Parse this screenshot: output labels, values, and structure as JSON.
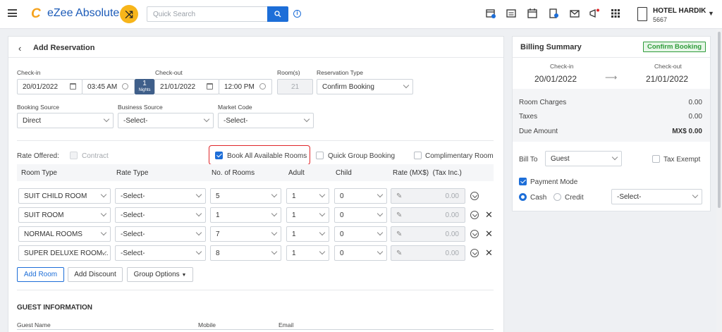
{
  "topbar": {
    "logo_mark": "C",
    "app_name": "eZee Absolute",
    "search_placeholder": "Quick Search",
    "hotel_name": "HOTEL HARDIK",
    "hotel_id": "5667"
  },
  "page": {
    "title": "Add Reservation"
  },
  "stay": {
    "checkin_label": "Check-in",
    "checkout_label": "Check-out",
    "rooms_label": "Room(s)",
    "restype_label": "Reservation Type",
    "checkin_date": "20/01/2022",
    "checkin_time": "03:45 AM",
    "nights_count": "1",
    "nights_label": "Nights",
    "checkout_date": "21/01/2022",
    "checkout_time": "12:00 PM",
    "rooms": "21",
    "reservation_type": "Confirm Booking"
  },
  "sources": {
    "booking_label": "Booking Source",
    "business_label": "Business Source",
    "market_label": "Market Code",
    "booking_value": "Direct",
    "business_value": "-Select-",
    "market_value": "-Select-"
  },
  "options": {
    "rate_offered": "Rate Offered:",
    "contract": "Contract",
    "book_all": "Book All Available Rooms",
    "quick_group": "Quick Group Booking",
    "complimentary": "Complimentary Room"
  },
  "table": {
    "headers": [
      "Room Type",
      "Rate Type",
      "No. of Rooms",
      "Adult",
      "Child",
      "Rate (MX$)  (Tax Inc.)"
    ],
    "rows": [
      {
        "room_type": "SUIT CHILD ROOM",
        "rate_type": "-Select-",
        "rooms": "5",
        "adult": "1",
        "child": "0",
        "rate": "0.00"
      },
      {
        "room_type": "SUIT ROOM",
        "rate_type": "-Select-",
        "rooms": "1",
        "adult": "1",
        "child": "0",
        "rate": "0.00"
      },
      {
        "room_type": "NORMAL ROOMS",
        "rate_type": "-Select-",
        "rooms": "7",
        "adult": "1",
        "child": "0",
        "rate": "0.00"
      },
      {
        "room_type": "SUPER DELUXE ROOM...",
        "rate_type": "-Select-",
        "rooms": "8",
        "adult": "1",
        "child": "0",
        "rate": "0.00"
      }
    ]
  },
  "buttons": {
    "add_room": "Add Room",
    "add_discount": "Add Discount",
    "group_options": "Group Options"
  },
  "guest": {
    "section_title": "GUEST INFORMATION",
    "name_label": "Guest Name",
    "mobile_label": "Mobile",
    "email_label": "Email"
  },
  "billing": {
    "title": "Billing Summary",
    "badge": "Confirm Booking",
    "checkin_label": "Check-in",
    "checkout_label": "Check-out",
    "checkin_date": "20/01/2022",
    "checkout_date": "21/01/2022",
    "arrow": "⟶",
    "room_charges_label": "Room Charges",
    "room_charges": "0.00",
    "taxes_label": "Taxes",
    "taxes": "0.00",
    "due_label": "Due Amount",
    "due": "MX$ 0.00",
    "bill_to_label": "Bill To",
    "bill_to_value": "Guest",
    "tax_exempt": "Tax Exempt",
    "payment_mode": "Payment Mode",
    "cash": "Cash",
    "credit": "Credit",
    "select": "-Select-"
  },
  "colors": {
    "accent": "#1d6ed8",
    "logo_orange": "#f5a21c",
    "badge_green": "#2e9b3a",
    "highlight_red": "#e0262a"
  }
}
